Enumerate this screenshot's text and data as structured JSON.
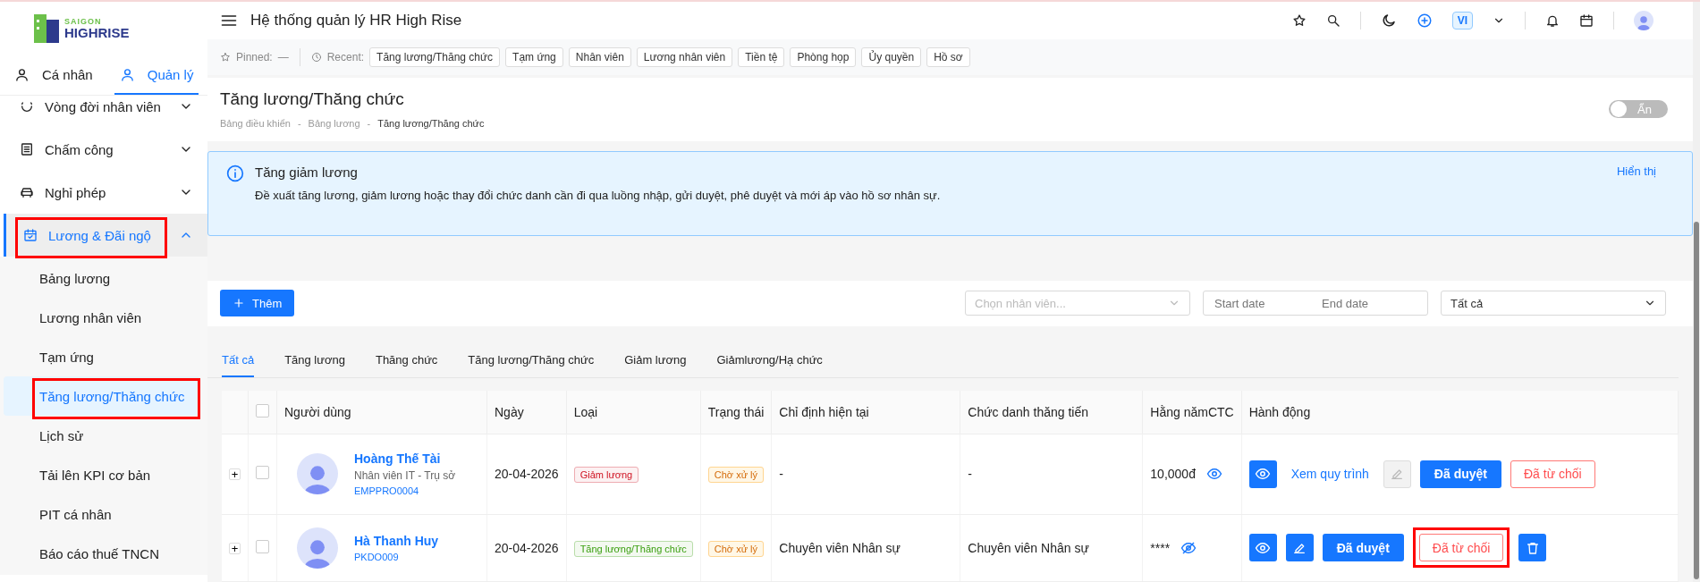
{
  "sidebar": {
    "logo": [
      "SAIGON",
      "HIGHRISE"
    ],
    "tabs": [
      {
        "label": "Cá nhân",
        "selected": false
      },
      {
        "label": "Quản lý",
        "selected": true
      }
    ],
    "items": [
      {
        "label": "Vòng đời nhân viên",
        "kind": "lifecycle",
        "expanded": false,
        "selected": false,
        "highlighted": false
      },
      {
        "label": "Chấm công",
        "kind": "attendance",
        "expanded": false,
        "selected": false,
        "highlighted": false
      },
      {
        "label": "Nghỉ phép",
        "kind": "leave",
        "expanded": false,
        "selected": false,
        "highlighted": false
      },
      {
        "label": "Lương & Đãi ngộ",
        "kind": "payroll",
        "expanded": true,
        "selected": true,
        "highlighted": true,
        "children": [
          {
            "label": "Bảng lương",
            "selected": false,
            "highlighted": false
          },
          {
            "label": "Lương nhân viên",
            "selected": false,
            "highlighted": false
          },
          {
            "label": "Tạm ứng",
            "selected": false,
            "highlighted": false
          },
          {
            "label": "Tăng lương/Thăng chức",
            "selected": true,
            "highlighted": true
          },
          {
            "label": "Lịch sử",
            "selected": false,
            "highlighted": false
          },
          {
            "label": "Tải lên KPI cơ bản",
            "selected": false,
            "highlighted": false
          },
          {
            "label": "PIT cá nhân",
            "selected": false,
            "highlighted": false
          },
          {
            "label": "Báo cáo thuế TNCN",
            "selected": false,
            "highlighted": false
          }
        ]
      }
    ]
  },
  "header": {
    "title": "Hệ thống quản lý HR High Rise",
    "language": "VI"
  },
  "quick_bar": {
    "pinned_label": "Pinned:",
    "pinned_value": "—",
    "recent_label": "Recent:",
    "recent": [
      "Tăng lương/Thăng chức",
      "Tạm ứng",
      "Nhân viên",
      "Lương nhân viên",
      "Tiền tệ",
      "Phòng họp",
      "Ủy quyền",
      "Hồ sơ"
    ]
  },
  "page": {
    "title": "Tăng lương/Thăng chức",
    "breadcrumbs": [
      "Bảng điều khiển",
      "-",
      "Bảng lương",
      "-",
      "Tăng lương/Thăng chức"
    ],
    "toggle": {
      "label": "Ẩn",
      "on": false
    }
  },
  "alert": {
    "title": "Tăng giảm lương",
    "text": "Đề xuất tăng lương, giảm lương hoặc thay đổi chức danh cần đi qua luồng nhập, gửi duyệt, phê duyệt và mới áp vào hồ sơ nhân sự.",
    "action": "Hiển thị"
  },
  "toolbar": {
    "add_button": "Thêm",
    "employee_placeholder": "Chọn nhân viên...",
    "start_placeholder": "Start date",
    "end_placeholder": "End date",
    "status_value": "Tất cả"
  },
  "tabs": [
    {
      "label": "Tất cả",
      "selected": true
    },
    {
      "label": "Tăng lương",
      "selected": false
    },
    {
      "label": "Thăng chức",
      "selected": false
    },
    {
      "label": "Tăng lương/Thăng chức",
      "selected": false
    },
    {
      "label": "Giảm lương",
      "selected": false
    },
    {
      "label": "Giảmlương/Hạ chức",
      "selected": false
    }
  ],
  "table": {
    "select_all_checked": false,
    "columns": [
      "Người dùng",
      "Ngày",
      "Loại",
      "Trạng thái",
      "Chỉ định hiện tại",
      "Chức danh thăng tiến",
      "Hằng nămCTC",
      "Hành động"
    ],
    "rows": [
      {
        "expand": "+",
        "checked": false,
        "name": "Hoàng Thế Tài",
        "subtitle": "Nhân viên IT - Trụ sở",
        "code": "EMPPRO0004",
        "date": "20-04-2026",
        "type": {
          "label": "Giảm lương",
          "color": "#cf1322"
        },
        "status": "Chờ xử lý",
        "current": "-",
        "promoted": "-",
        "ctc": "10,000đ",
        "ctc_visible": true,
        "actions": [
          {
            "kind": "view",
            "highlighted": false
          },
          {
            "kind": "link",
            "label": "Xem quy trình",
            "highlighted": false
          },
          {
            "kind": "edit",
            "disabled": true,
            "highlighted": false
          },
          {
            "kind": "approve",
            "label": "Đã duyệt",
            "highlighted": false
          },
          {
            "kind": "reject",
            "label": "Đã từ chối",
            "highlighted": false
          }
        ]
      },
      {
        "expand": "+",
        "checked": false,
        "name": "Hà Thanh Huy",
        "code": "PKDO009",
        "date": "20-04-2026",
        "type": {
          "label": "Tăng lương/Thăng chức",
          "color": "#389e0d"
        },
        "status": "Chờ xử lý",
        "current": "Chuyên viên Nhân sự",
        "promoted": "Chuyên viên Nhân sự",
        "ctc": "****",
        "ctc_visible": false,
        "actions": [
          {
            "kind": "view",
            "highlighted": false
          },
          {
            "kind": "edit",
            "disabled": false,
            "highlighted": false
          },
          {
            "kind": "approve",
            "label": "Đã duyệt",
            "highlighted": false
          },
          {
            "kind": "reject",
            "label": "Đã từ chối",
            "highlighted": true
          },
          {
            "kind": "delete",
            "highlighted": false
          }
        ]
      }
    ]
  }
}
